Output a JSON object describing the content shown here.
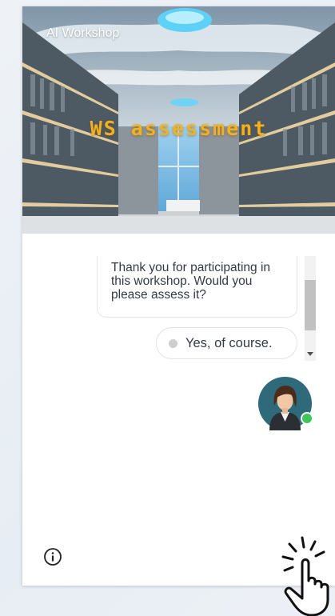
{
  "header": {
    "brand": "AI Workshop",
    "title": "WS assessment"
  },
  "chat": {
    "message": "Thank you for participating in this workshop. Would you please assess it?",
    "quick_reply": "Yes, of course."
  },
  "icons": {
    "info": "info-icon",
    "avatar": "assistant-avatar",
    "status": "online-status-icon",
    "pointer": "click-hand-icon"
  },
  "colors": {
    "title": "#f0b21f",
    "online": "#3fc65a",
    "avatar_bg": "#2f6a7a"
  }
}
